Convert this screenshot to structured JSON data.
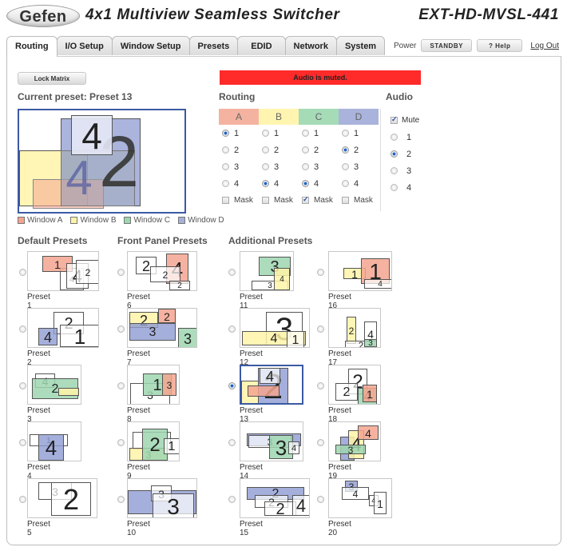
{
  "header": {
    "logo": "Gefen",
    "title": "4x1 Multiview Seamless Switcher",
    "model": "EXT-HD-MVSL-441"
  },
  "tabs": [
    {
      "label": "Routing",
      "active": true
    },
    {
      "label": "I/O Setup",
      "active": false
    },
    {
      "label": "Window Setup",
      "active": false
    },
    {
      "label": "Presets",
      "active": false
    },
    {
      "label": "EDID",
      "active": false
    },
    {
      "label": "Network",
      "active": false
    },
    {
      "label": "System",
      "active": false
    }
  ],
  "topbar": {
    "power_label": "Power",
    "standby_label": "STANDBY",
    "help_label": "? Help",
    "logout_label": "Log Out"
  },
  "lock_matrix_label": "Lock Matrix",
  "current_preset_label": "Current preset: Preset 13",
  "alert_text": "Audio is muted.",
  "colors": {
    "A": "#f4a48f",
    "B": "#fff3a8",
    "C": "#9ed6b0",
    "D": "#a7b0d9",
    "alert": "#ff2a2a",
    "selected_border": "#3b5aa3"
  },
  "legend": [
    {
      "key": "A",
      "label": "Window A"
    },
    {
      "key": "B",
      "label": "Window B"
    },
    {
      "key": "C",
      "label": "Window C"
    },
    {
      "key": "D",
      "label": "Window D"
    }
  ],
  "routing": {
    "title": "Routing",
    "columns": [
      "A",
      "B",
      "C",
      "D"
    ],
    "inputs": [
      "1",
      "2",
      "3",
      "4"
    ],
    "selected": {
      "A": "1",
      "B": "4",
      "C": "4",
      "D": "2"
    },
    "mask_label": "Mask",
    "mask": {
      "A": false,
      "B": false,
      "C": true,
      "D": false
    }
  },
  "audio": {
    "title": "Audio",
    "mute_label": "Mute",
    "muted": true,
    "inputs": [
      "1",
      "2",
      "3",
      "4"
    ],
    "selected": "2"
  },
  "preset_groups": [
    {
      "title": "Default Presets"
    },
    {
      "title": "Front Panel Presets"
    },
    {
      "title": "Additional Presets"
    }
  ],
  "presets": [
    {
      "label": "Preset 1",
      "selected": false
    },
    {
      "label": "Preset 2",
      "selected": false
    },
    {
      "label": "Preset 3",
      "selected": false
    },
    {
      "label": "Preset 4",
      "selected": false
    },
    {
      "label": "Preset 5",
      "selected": false
    },
    {
      "label": "Preset 6",
      "selected": false
    },
    {
      "label": "Preset 7",
      "selected": false
    },
    {
      "label": "Preset 8",
      "selected": false
    },
    {
      "label": "Preset 9",
      "selected": false
    },
    {
      "label": "Preset 10",
      "selected": false
    },
    {
      "label": "Preset 11",
      "selected": false
    },
    {
      "label": "Preset 12",
      "selected": false
    },
    {
      "label": "Preset 13",
      "selected": true
    },
    {
      "label": "Preset 14",
      "selected": false
    },
    {
      "label": "Preset 15",
      "selected": false
    },
    {
      "label": "Preset 16",
      "selected": false
    },
    {
      "label": "Preset 17",
      "selected": false
    },
    {
      "label": "Preset 18",
      "selected": false
    },
    {
      "label": "Preset 19",
      "selected": false
    },
    {
      "label": "Preset 20",
      "selected": false
    }
  ]
}
